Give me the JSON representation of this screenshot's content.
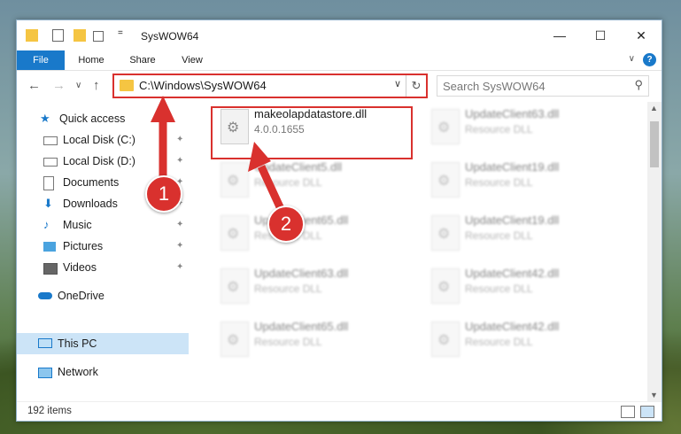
{
  "window": {
    "title": "SysWOW64",
    "quick_access_toolbar_dropdown": "=",
    "minimize_symbol": "—",
    "maximize_symbol": "☐",
    "close_symbol": "✕"
  },
  "ribbon": {
    "tabs": [
      "File",
      "Home",
      "Share",
      "View"
    ],
    "collapse_symbol": "∨",
    "help_symbol": "?"
  },
  "navigation": {
    "back_symbol": "←",
    "forward_symbol": "→",
    "recent_symbol": "∨",
    "up_symbol": "↑",
    "address": "C:\\Windows\\SysWOW64",
    "address_dropdown_symbol": "∨",
    "refresh_symbol": "↻",
    "search_placeholder": "Search SysWOW64",
    "search_icon_symbol": "⚲"
  },
  "sidebar": {
    "items": [
      {
        "label": "Quick access",
        "icon": "star-icon",
        "pinned": false
      },
      {
        "label": "Local Disk (C:)",
        "icon": "disk-icon",
        "pinned": true
      },
      {
        "label": "Local Disk (D:)",
        "icon": "disk-icon",
        "pinned": true
      },
      {
        "label": "Documents",
        "icon": "document-icon",
        "pinned": true
      },
      {
        "label": "Downloads",
        "icon": "download-icon",
        "pinned": true
      },
      {
        "label": "Music",
        "icon": "music-icon",
        "pinned": true
      },
      {
        "label": "Pictures",
        "icon": "picture-icon",
        "pinned": true
      },
      {
        "label": "Videos",
        "icon": "video-icon",
        "pinned": true
      },
      {
        "label": "OneDrive",
        "icon": "cloud-icon",
        "pinned": false
      },
      {
        "label": "This PC",
        "icon": "computer-icon",
        "pinned": false,
        "selected": true
      },
      {
        "label": "Network",
        "icon": "network-icon",
        "pinned": false
      }
    ],
    "pin_symbol": "📌"
  },
  "files": [
    {
      "name": "makeolapdatastore.dll",
      "sub": "4.0.0.1655",
      "highlighted": true
    },
    {
      "name": "UpdateClient63.dll",
      "sub": "Resource DLL"
    },
    {
      "name": "UpdateClient5.dll",
      "sub": "Resource DLL"
    },
    {
      "name": "UpdateClient19.dll",
      "sub": "Resource DLL"
    },
    {
      "name": "UpdateClient65.dll",
      "sub": "Resource DLL"
    },
    {
      "name": "UpdateClient19.dll",
      "sub": "Resource DLL"
    },
    {
      "name": "UpdateClient63.dll",
      "sub": "Resource DLL"
    },
    {
      "name": "UpdateClient42.dll",
      "sub": "Resource DLL"
    },
    {
      "name": "UpdateClient65.dll",
      "sub": "Resource DLL"
    },
    {
      "name": "UpdateClient42.dll",
      "sub": "Resource DLL"
    }
  ],
  "status": {
    "item_count": "192 items"
  },
  "callouts": [
    "1",
    "2"
  ],
  "colors": {
    "accent": "#1979ca",
    "callout_red": "#d9312e",
    "selection": "#cce4f7"
  }
}
